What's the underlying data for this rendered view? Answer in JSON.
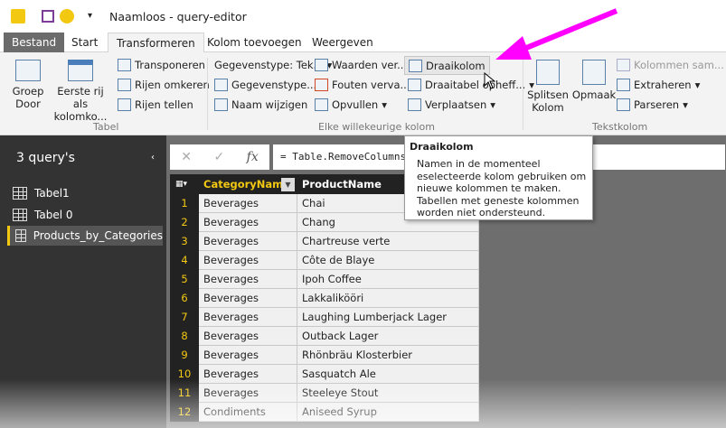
{
  "window": {
    "title": "Naamloos - query-editor"
  },
  "tabs": [
    "Bestand",
    "Start",
    "Transformeren",
    "Kolom toevoegen",
    "Weergeven"
  ],
  "ribbon": {
    "tabel": {
      "groep_door": "Groep Door",
      "eerste_rij": "Eerste rij als kolomko...",
      "transponeren": "Transponeren",
      "rijen_omkeren": "Rijen omkeren",
      "rijen_tellen": "Rijen tellen",
      "group_label": "Tabel"
    },
    "kolom": {
      "gegevenstype": "Gegevenstype: Tek...",
      "gegevenstype2": "Gegevenstype...",
      "naam_wijzigen": "Naam wijzigen",
      "waarden": "Waarden ver...",
      "fouten": "Fouten verva...",
      "opvullen": "Opvullen",
      "draaikolom": "Draaikolom",
      "draaitabel": "Draaitabel opheff...",
      "verplaatsen": "Verplaatsen",
      "group_label": "Elke willekeurige kolom"
    },
    "tekst": {
      "splitsen": "Splitsen Kolom",
      "opmaak": "Opmaak",
      "kolommen_sam": "Kolommen sam...",
      "extraheren": "Extraheren",
      "parseren": "Parseren",
      "group_label": "Tekstkolom"
    }
  },
  "tooltip": {
    "title": "Draaikolom",
    "body": "Namen in de momenteel eselecteerde kolom gebruiken om nieuwe kolommen te maken. Tabellen met geneste kolommen worden niet ondersteund."
  },
  "queries": {
    "title": "3 query's",
    "items": [
      "Tabel1",
      "Tabel 0",
      "Products_by_Categories"
    ]
  },
  "formula": "= Table.RemoveColumns",
  "table": {
    "headers": [
      "CategoryName",
      "ProductName"
    ],
    "rows": [
      [
        "1",
        "Beverages",
        "Chai"
      ],
      [
        "2",
        "Beverages",
        "Chang"
      ],
      [
        "3",
        "Beverages",
        "Chartreuse verte"
      ],
      [
        "4",
        "Beverages",
        "Côte de Blaye"
      ],
      [
        "5",
        "Beverages",
        "Ipoh Coffee"
      ],
      [
        "6",
        "Beverages",
        "Lakkalikööri"
      ],
      [
        "7",
        "Beverages",
        "Laughing Lumberjack Lager"
      ],
      [
        "8",
        "Beverages",
        "Outback Lager"
      ],
      [
        "9",
        "Beverages",
        "Rhönbräu Klosterbier"
      ],
      [
        "10",
        "Beverages",
        "Sasquatch Ale"
      ],
      [
        "11",
        "Beverages",
        "Steeleye Stout"
      ],
      [
        "12",
        "Condiments",
        "Aniseed Syrup"
      ]
    ]
  },
  "colors": {
    "accent": "#f2c811",
    "arrow": "#ff00ff",
    "bestand": "#6b6b6b"
  }
}
